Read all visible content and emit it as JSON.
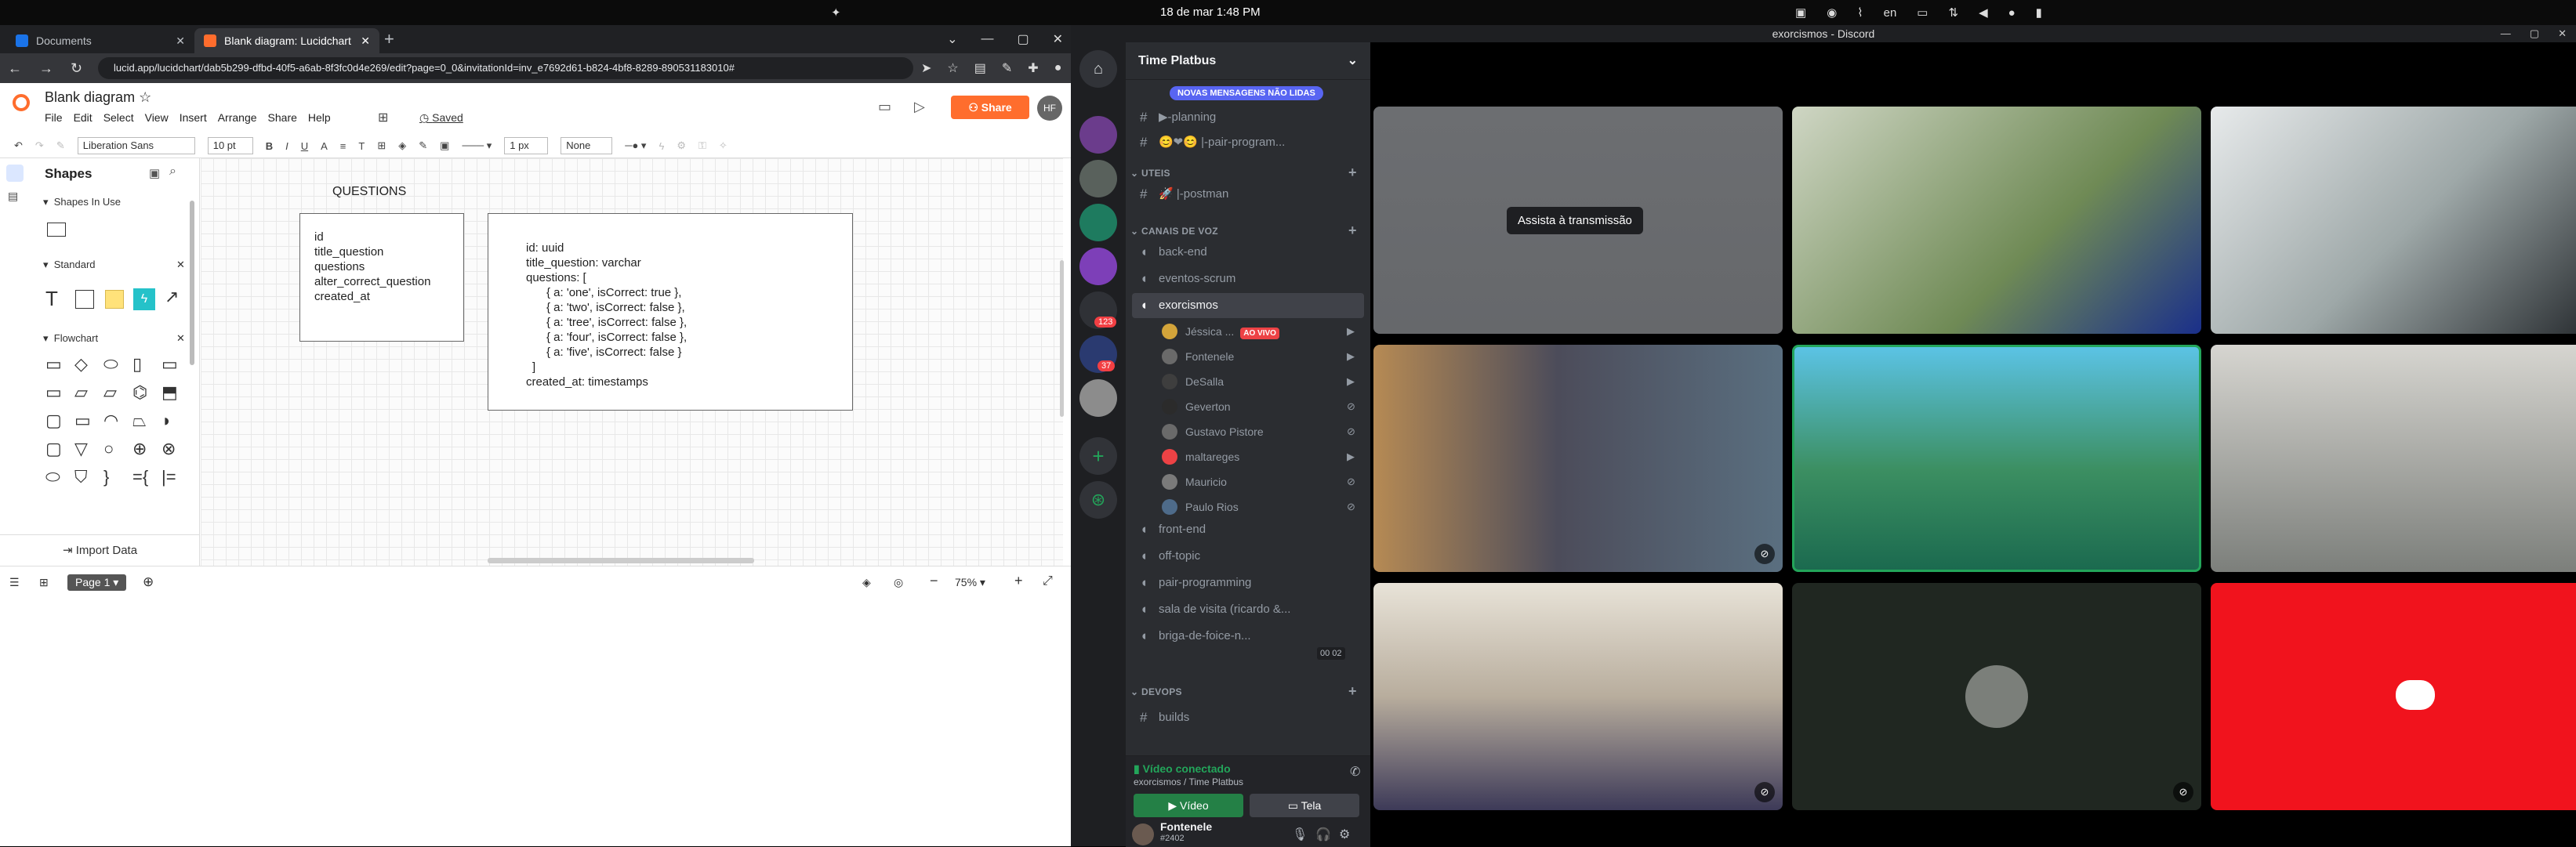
{
  "topbar": {
    "date_time": "18 de mar   1:48 PM",
    "lang": "en"
  },
  "browser": {
    "tabs": [
      {
        "title": "Documents"
      },
      {
        "title": "Blank diagram: Lucidchart"
      }
    ],
    "url": "lucid.app/lucidchart/dab5b299-dfbd-40f5-a6ab-8f3fc0d4e269/edit?page=0_0&invitationId=inv_e7692d61-b824-4bf8-8289-890531183010#"
  },
  "lucid": {
    "doc_title": "Blank diagram",
    "menus": [
      "File",
      "Edit",
      "Select",
      "View",
      "Insert",
      "Arrange",
      "Share",
      "Help"
    ],
    "saved": "Saved",
    "share": "Share",
    "avatar": "HF",
    "toolbar": {
      "font": "Liberation Sans",
      "font_size": "10 pt",
      "line_width": "1 px",
      "arrow_none": "None"
    },
    "panel_title": "Shapes",
    "sections": {
      "in_use": "Shapes In Use",
      "standard": "Standard",
      "flowchart": "Flowchart"
    },
    "import": "Import Data",
    "page_tab": "Page 1",
    "zoom": "75%",
    "canvas": {
      "label": "QUESTIONS",
      "box1": [
        "id",
        "title_question",
        "questions",
        "alter_correct_question",
        "created_at"
      ],
      "box2": [
        "id: uuid",
        "title_question: varchar",
        "questions: [",
        "{ a: 'one', isCorrect: true },",
        "{ a: 'two', isCorrect: false },",
        "{ a: 'tree', isCorrect: false },",
        "{ a: 'four', isCorrect: false },",
        "{ a: 'five', isCorrect: false }",
        "]",
        "created_at: timestamps"
      ]
    }
  },
  "discord": {
    "window_title": "exorcismos - Discord",
    "server_name": "Time Platbus",
    "new_messages": "NOVAS MENSAGENS NÃO LIDAS",
    "badges": [
      "123",
      "37"
    ],
    "channels_top": [
      "planning",
      "|-pair-program..."
    ],
    "cat_uteis": "UTEIS",
    "postman": "|-postman",
    "cat_voice": "CANAIS DE VOZ",
    "voice": [
      "back-end",
      "eventos-scrum",
      "exorcismos"
    ],
    "live": "AO VIVO",
    "users": [
      "Jéssica ...",
      "Fontenele",
      "DeSalla",
      "Geverton",
      "Gustavo Pistore",
      "maltareges",
      "Mauricio",
      "Paulo Rios"
    ],
    "voice_more": [
      "front-end",
      "off-topic",
      "pair-programming",
      "sala de visita (ricardo &...",
      "briga-de-foice-n..."
    ],
    "counter": "00  02",
    "cat_devops": "DEVOPS",
    "builds": "builds",
    "conn_status": "Vídeo conectado",
    "conn_sub": "exorcismos / Time Platbus",
    "btn_video": "Vídeo",
    "btn_tela": "Tela",
    "me_name": "Fontenele",
    "me_tag": "#2402",
    "watch": "Assista à transmissão"
  }
}
